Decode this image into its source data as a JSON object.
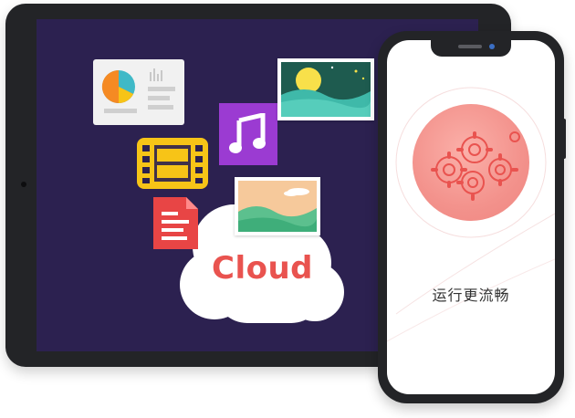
{
  "cloud": {
    "label": "Cloud"
  },
  "phone": {
    "caption": "运行更流畅"
  },
  "colors": {
    "tablet_frame": "#232427",
    "tablet_screen": "#2c2150",
    "cloud_text": "#e9534f",
    "music_tile": "#9b3bd2",
    "film_tile": "#f7c417",
    "document_icon": "#e84545",
    "gear_circle": "#f3928c"
  },
  "icons": [
    "chart-card-icon",
    "music-note-icon",
    "film-icon",
    "document-icon",
    "photo-icon",
    "gears-icon"
  ]
}
